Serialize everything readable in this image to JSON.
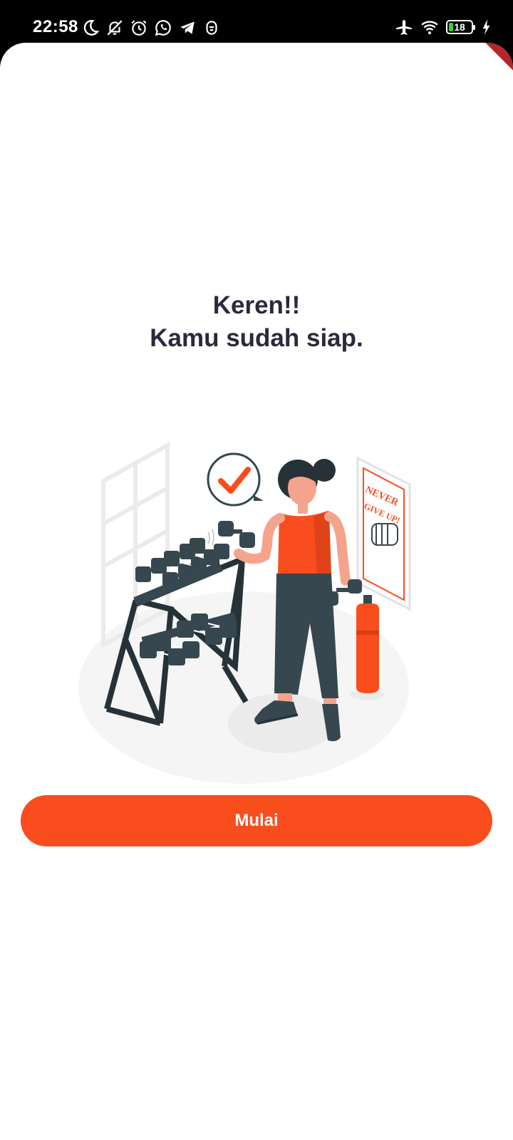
{
  "status_bar": {
    "time": "22:58",
    "battery_level": "18",
    "icons_left": [
      "moon-icon",
      "bell-off-icon",
      "alarm-icon",
      "whatsapp-icon",
      "telegram-icon",
      "app-notification-icon"
    ],
    "icons_right": [
      "airplane-icon",
      "wifi-icon",
      "battery-icon",
      "charging-icon"
    ]
  },
  "main": {
    "title_line1": "Keren!!",
    "title_line2": "Kamu sudah siap.",
    "poster_line1": "NEVER",
    "poster_line2": "GIVE UP!",
    "start_button_label": "Mulai"
  },
  "colors": {
    "accent": "#fa4d1d",
    "title": "#2a2a3c",
    "equipment": "#37474f"
  }
}
